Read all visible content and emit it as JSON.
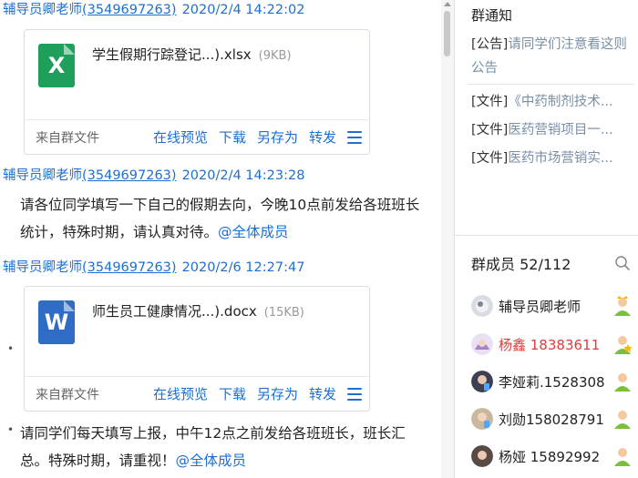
{
  "chat": {
    "messages": [
      {
        "sender": "辅导员卿老师",
        "qq": "(3549697263)",
        "time": "2020/2/4 14:22:02",
        "file": {
          "name": "学生假期行踪登记...).xlsx",
          "size": "(9KB)",
          "source": "来自群文件",
          "actions": [
            "在线预览",
            "下载",
            "另存为",
            "转发"
          ],
          "icon": "excel-icon",
          "icon_letter": "X",
          "icon_color": "#1e9f5a"
        }
      },
      {
        "sender": "辅导员卿老师",
        "qq": "(3549697263)",
        "time": "2020/2/4 14:23:28",
        "text": "请各位同学填写一下自己的假期去向，今晚10点前发给各班班长统计，特殊时期，请认真对待。",
        "mention": "@全体成员"
      },
      {
        "sender": "辅导员卿老师",
        "qq": "(3549697263)",
        "time": "2020/2/6 12:27:47",
        "file": {
          "name": "师生员工健康情况...).docx",
          "size": "(15KB)",
          "source": "来自群文件",
          "actions": [
            "在线预览",
            "下载",
            "另存为",
            "转发"
          ],
          "icon": "word-icon",
          "icon_letter": "W",
          "icon_color": "#2e6cc6"
        }
      },
      {
        "text": "请同学们每天填写上报，中午12点之前发给各班班长，班长汇总。特殊时期，请重视！",
        "mention": "@全体成员"
      }
    ]
  },
  "sidebar": {
    "notice_title": "群通知",
    "notices": [
      {
        "tag": "[公告]",
        "text": "请同学们注意看这则公告"
      },
      {
        "tag": "[文件]",
        "text": "《中药制剂技术..."
      },
      {
        "tag": "[文件]",
        "text": "医药营销项目一..."
      },
      {
        "tag": "[文件]",
        "text": "医药市场营销实..."
      }
    ],
    "members_title": "群成员 52/112",
    "members": [
      {
        "name": "辅导员卿老师",
        "highlight": false,
        "role": "owner-crown-icon"
      },
      {
        "name": "杨鑫 18383611",
        "highlight": true,
        "role": "admin-star-icon"
      },
      {
        "name": "李娅莉.1528308",
        "highlight": false,
        "role": "member-icon"
      },
      {
        "name": "刘勋158028791",
        "highlight": false,
        "role": "member-icon"
      },
      {
        "name": "杨娅 15892992",
        "highlight": false,
        "role": "member-icon"
      }
    ]
  },
  "colors": {
    "link_blue": "#1d6fd1",
    "admin_red": "#e23a3a",
    "muted_link": "#7a8fa8"
  }
}
